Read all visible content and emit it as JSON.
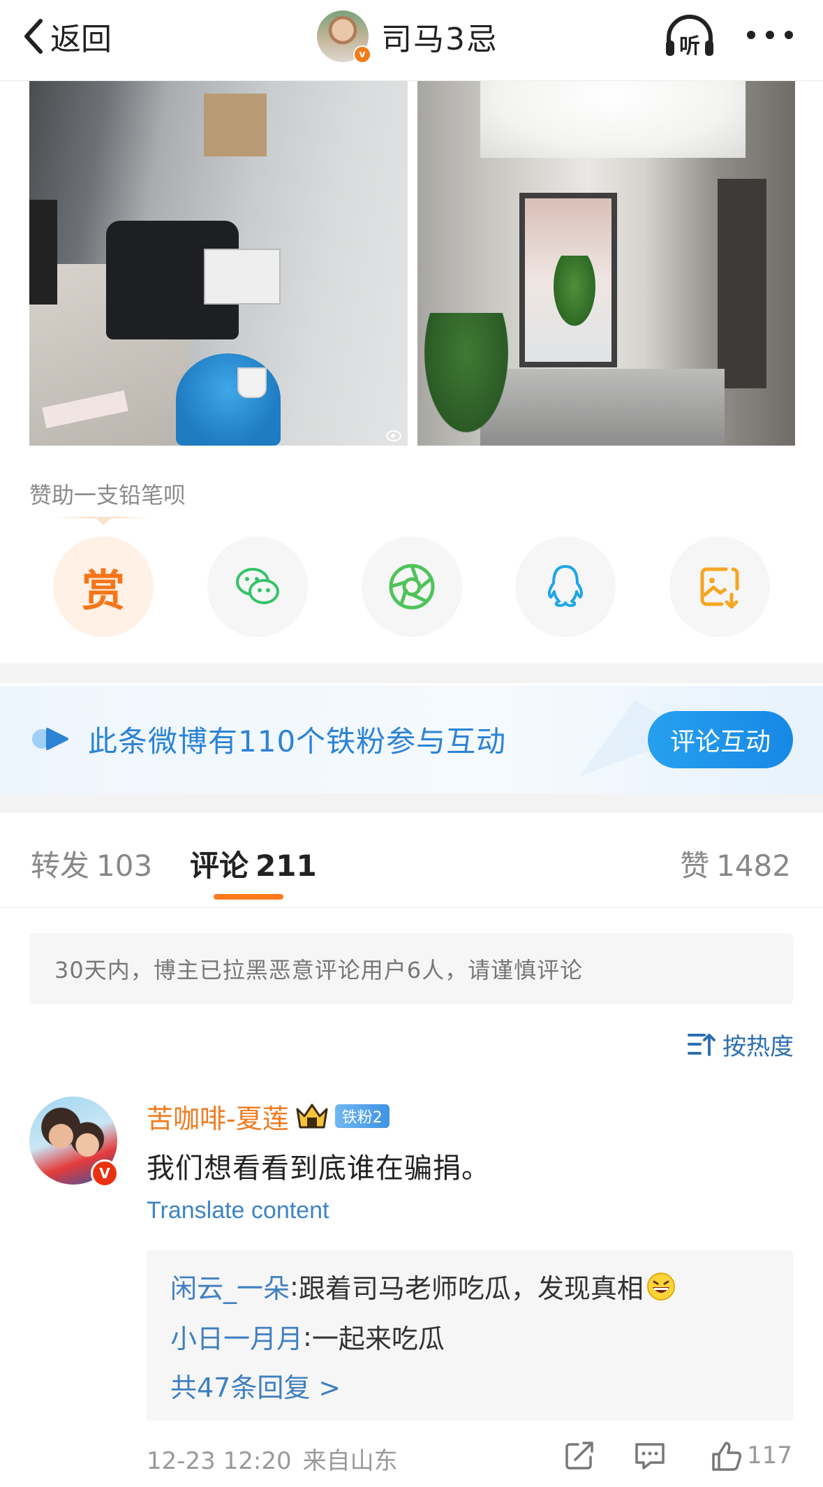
{
  "header": {
    "back_label": "返回",
    "title": "司马3忌",
    "icons": {
      "back": "chevron-left-icon",
      "listen": "headphones-listen-icon",
      "more": "more-dots-icon"
    },
    "listen_label": "听"
  },
  "photos": [
    {
      "name": "office-desk-photo"
    },
    {
      "name": "office-corridor-photo"
    }
  ],
  "sponsor": {
    "label": "赞助一支铅笔呗",
    "reward_char": "赏",
    "buttons": [
      "reward-icon",
      "wechat-icon",
      "moments-icon",
      "qq-icon",
      "save-image-icon"
    ]
  },
  "banner": {
    "text": "此条微博有110个铁粉参与互动",
    "button_label": "评论互动"
  },
  "tabs": {
    "repost_label": "转发",
    "repost_count": "103",
    "comment_label": "评论",
    "comment_count": "211",
    "like_label": "赞",
    "like_count": "1482"
  },
  "notice": "30天内，博主已拉黑恶意评论用户6人，请谨慎评论",
  "sort": {
    "label": "按热度"
  },
  "comment": {
    "author": "苦咖啡-夏莲",
    "fan_badge": "铁粉2",
    "verified_mark": "V",
    "text": "我们想看看到底谁在骗捐。",
    "translate": "Translate content",
    "replies": [
      {
        "user": "闲云_一朵",
        "sep": ": ",
        "text": "跟着司马老师吃瓜，发现真相"
      },
      {
        "user": "小日一月月",
        "sep": ": ",
        "text": "一起来吃瓜"
      }
    ],
    "reply_more": "共47条回复 >",
    "time": "12-23 12:20",
    "source": "来自山东",
    "like_count": "117"
  },
  "colors": {
    "accent_orange": "#f5761a",
    "link_blue": "#3f7fc0",
    "banner_blue": "#2c83d5",
    "wechat_green": "#36c36a",
    "qq_blue": "#1ea6e8",
    "save_orange": "#f5a623"
  }
}
